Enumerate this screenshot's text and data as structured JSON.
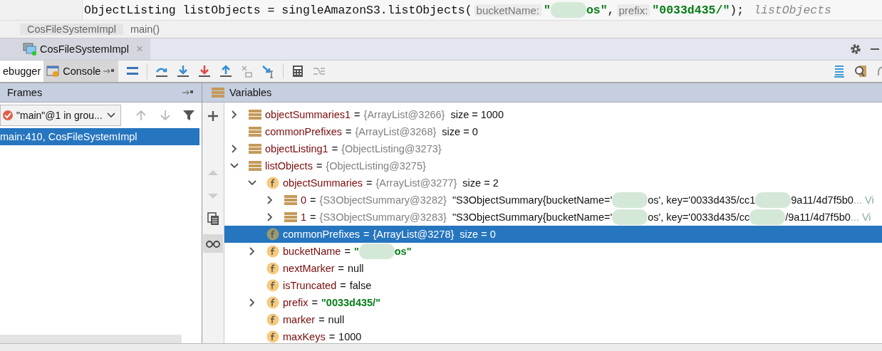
{
  "editor": {
    "code": "ObjectListing listObjects = singleAmazonS3.listObjects(",
    "args": [
      {
        "hint": "bucketName:",
        "value_parts": [
          "\"",
          "os\""
        ]
      },
      {
        "hint": "prefix:",
        "value_parts": [
          "\"0033d435/\""
        ]
      }
    ],
    "separator": ",",
    "end": ");",
    "inline_value": "listObjects"
  },
  "breadcrumbs": [
    "CosFileSystemImpl",
    "main()"
  ],
  "session_tab": {
    "label": "CosFileSystemImpl",
    "close": "×"
  },
  "tabs": [
    {
      "label": "ebugger",
      "selected": true
    },
    {
      "label": "Console",
      "selected": false
    }
  ],
  "frames": {
    "title": "Frames",
    "thread": "\"main\"@1 in grou...",
    "items": [
      {
        "label": "main:410, CosFileSystemImpl",
        "selected": true
      }
    ]
  },
  "variables": {
    "title": "Variables",
    "equals": "=",
    "rows": [
      {
        "kind": "local",
        "expandable": true,
        "expanded": false,
        "name": "objectSummaries1",
        "ref": "{ArrayList@3266}",
        "value_parts": [
          "size = 1000"
        ],
        "quoted": false,
        "selected": false
      },
      {
        "kind": "local",
        "expandable": false,
        "name": "commonPrefixes",
        "ref": "{ArrayList@3268}",
        "value_parts": [
          "size = 0"
        ],
        "quoted": false,
        "selected": false
      },
      {
        "kind": "local",
        "expandable": true,
        "expanded": false,
        "name": "objectListing1",
        "ref": "{ObjectListing@3273}",
        "selected": false
      },
      {
        "kind": "local",
        "expandable": true,
        "expanded": true,
        "name": "listObjects",
        "ref": "{ObjectListing@3275}",
        "selected": false,
        "children": [
          {
            "kind": "field",
            "expandable": true,
            "expanded": true,
            "name": "objectSummaries",
            "ref": "{ArrayList@3277}",
            "value_parts": [
              "size = 2"
            ],
            "quoted": false,
            "selected": false,
            "children": [
              {
                "kind": "local",
                "expandable": true,
                "expanded": false,
                "name": "0",
                "ref": "{S3ObjectSummary@3282}",
                "value_parts": [
                  "\"S3ObjectSummary{bucketName='",
                  "os', key='0033d435/cc1",
                  "9a11/4d7f5b0"
                ],
                "quoted": false,
                "more": "... Vi",
                "selected": false
              },
              {
                "kind": "local",
                "expandable": true,
                "expanded": false,
                "name": "1",
                "ref": "{S3ObjectSummary@3283}",
                "value_parts": [
                  "\"S3ObjectSummary{bucketName='",
                  "os', key='0033d435/cc",
                  "/9a11/4d7f5b0"
                ],
                "quoted": false,
                "more": "... Vi",
                "selected": false
              }
            ]
          },
          {
            "kind": "field",
            "expandable": false,
            "name": "commonPrefixes",
            "ref": "{ArrayList@3278}",
            "value_parts": [
              "size = 0"
            ],
            "quoted": false,
            "selected": true
          },
          {
            "kind": "field",
            "expandable": true,
            "expanded": false,
            "name": "bucketName",
            "value_parts": [
              "\"",
              "os\""
            ],
            "quoted": true,
            "selected": false
          },
          {
            "kind": "field",
            "expandable": false,
            "name": "nextMarker",
            "value_parts": [
              "null"
            ],
            "quoted": false,
            "selected": false
          },
          {
            "kind": "field",
            "expandable": false,
            "name": "isTruncated",
            "value_parts": [
              "false"
            ],
            "quoted": false,
            "selected": false
          },
          {
            "kind": "field",
            "expandable": true,
            "expanded": false,
            "name": "prefix",
            "value_parts": [
              "\"0033d435/\""
            ],
            "quoted": true,
            "selected": false
          },
          {
            "kind": "field",
            "expandable": false,
            "name": "marker",
            "value_parts": [
              "null"
            ],
            "quoted": false,
            "selected": false
          },
          {
            "kind": "field",
            "expandable": false,
            "name": "maxKeys",
            "value_parts": [
              "1000"
            ],
            "quoted": false,
            "selected": false
          }
        ]
      }
    ]
  }
}
